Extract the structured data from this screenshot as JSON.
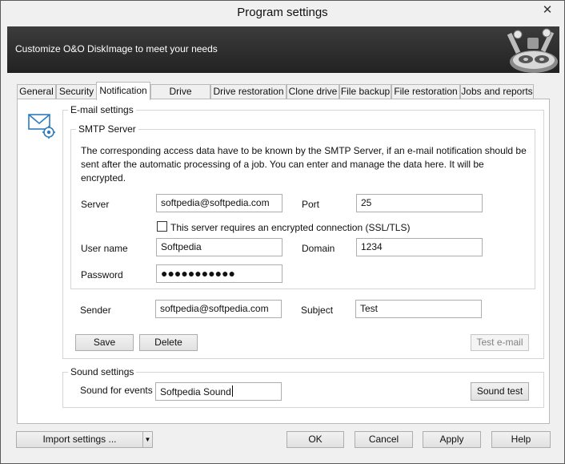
{
  "window": {
    "title": "Program settings",
    "close_glyph": "✕"
  },
  "banner": {
    "text": "Customize O&O DiskImage to meet your needs"
  },
  "tabs": [
    {
      "label": "General"
    },
    {
      "label": "Security"
    },
    {
      "label": "Notification",
      "active": true
    },
    {
      "label": "Drive Imaging"
    },
    {
      "label": "Drive restoration"
    },
    {
      "label": "Clone drive"
    },
    {
      "label": "File backup"
    },
    {
      "label": "File restoration"
    },
    {
      "label": "Jobs and reports"
    }
  ],
  "email": {
    "group_label": "E-mail settings",
    "icon": "mail-settings-icon",
    "smtp": {
      "group_label": "SMTP Server",
      "description": "The corresponding access data have to be known by the SMTP Server, if an e-mail notification should be sent after the automatic processing of a job. You can enter and manage the data here. It will be encrypted.",
      "server_label": "Server",
      "server_value": "softpedia@softpedia.com",
      "port_label": "Port",
      "port_value": "25",
      "ssl_label": "This server requires an encrypted connection (SSL/TLS)",
      "ssl_checked": false,
      "username_label": "User name",
      "username_value": "Softpedia",
      "domain_label": "Domain",
      "domain_value": "1234",
      "password_label": "Password",
      "password_value": "●●●●●●●●●●●"
    },
    "sender_label": "Sender",
    "sender_value": "softpedia@softpedia.com",
    "subject_label": "Subject",
    "subject_value": "Test",
    "save_label": "Save",
    "delete_label": "Delete",
    "test_email_label": "Test e-mail"
  },
  "sound": {
    "group_label": "Sound settings",
    "events_label": "Sound for events",
    "events_value": "Softpedia Sound",
    "test_label": "Sound test"
  },
  "footer": {
    "import_label": "Import settings ...",
    "import_arrow": "▼",
    "ok_label": "OK",
    "cancel_label": "Cancel",
    "apply_label": "Apply",
    "help_label": "Help"
  }
}
